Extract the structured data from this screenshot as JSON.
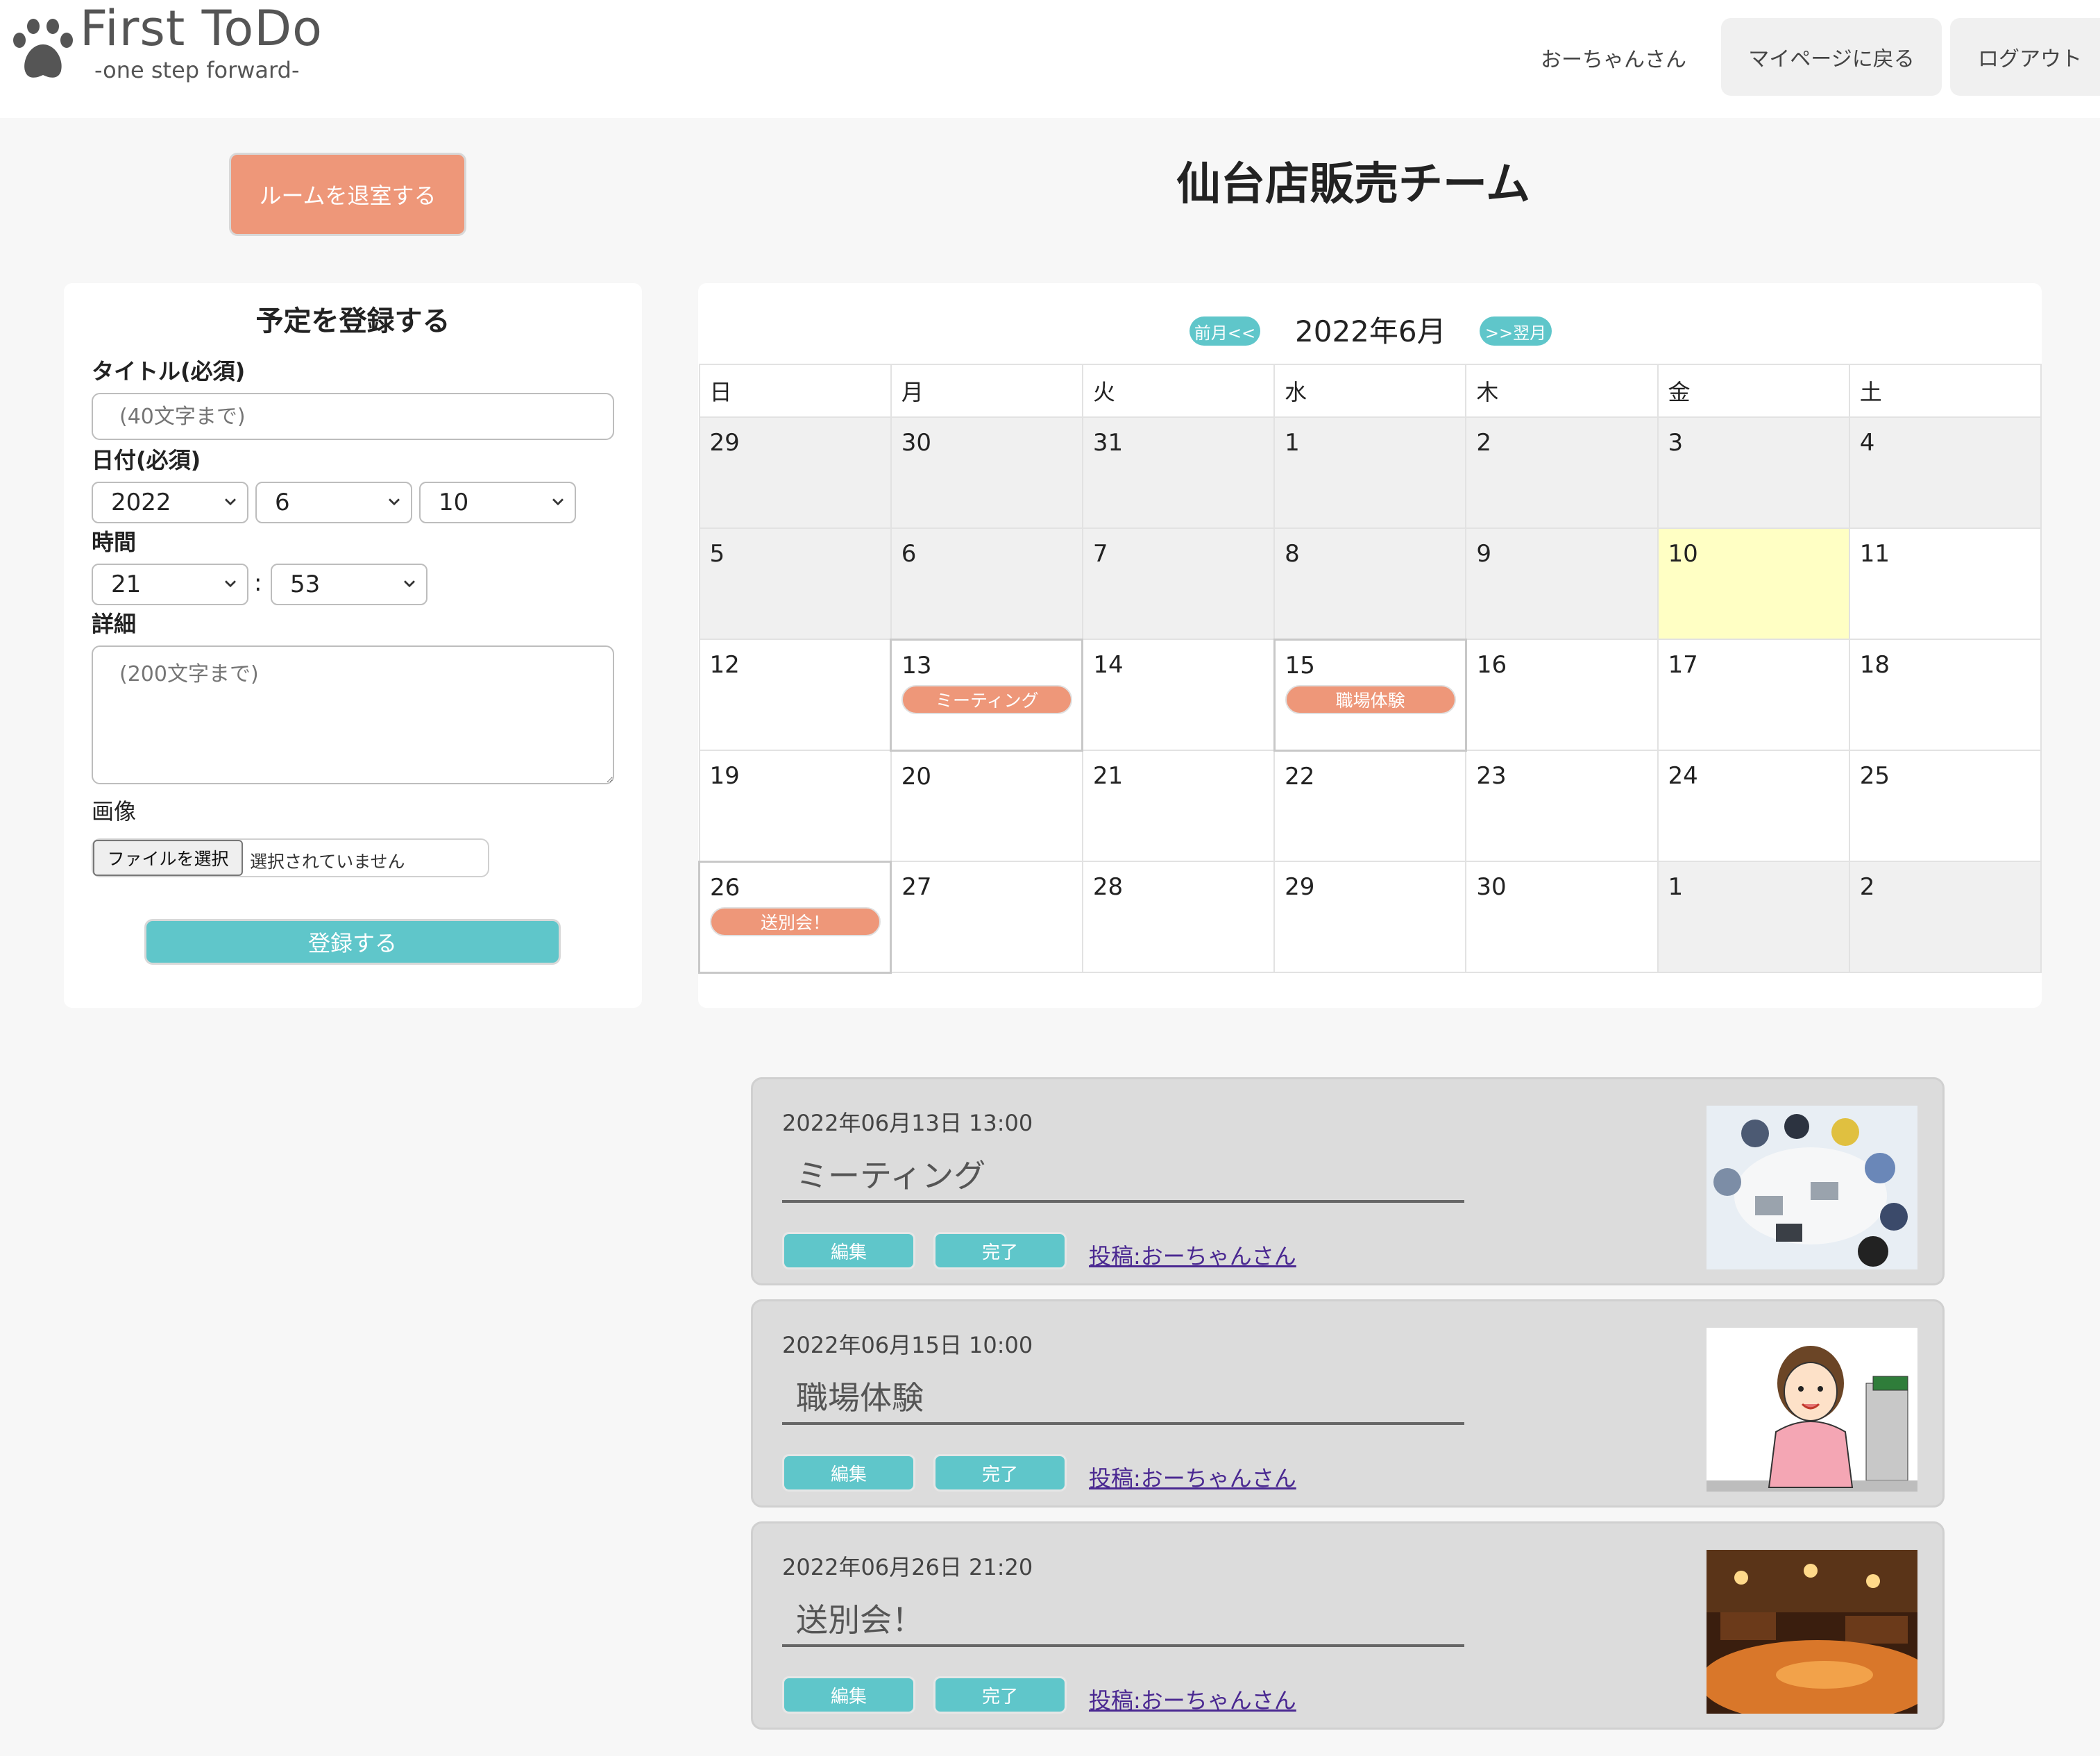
{
  "header": {
    "logo_title": "First ToDo",
    "logo_subtitle": "-one step forward-",
    "user_name": "おーちゃんさん",
    "mypage_label": "マイページに戻る",
    "logout_label": "ログアウト"
  },
  "room": {
    "leave_label": "ルームを退室する",
    "title": "仙台店販売チーム"
  },
  "form": {
    "heading": "予定を登録する",
    "title_label": "タイトル(必須)",
    "title_placeholder": "(40文字まで)",
    "date_label": "日付(必須)",
    "year_value": "2022",
    "month_value": "6",
    "day_value": "10",
    "time_label": "時間",
    "hour_value": "21",
    "time_separator": ":",
    "minute_value": "53",
    "detail_label": "詳細",
    "detail_placeholder": "(200文字まで)",
    "image_label": "画像",
    "file_button": "ファイルを選択",
    "file_status": "選択されていません",
    "submit_label": "登録する"
  },
  "calendar": {
    "prev_label": "前月<<",
    "month_label": "2022年6月",
    "next_label": ">>翌月",
    "weekdays": [
      "日",
      "月",
      "火",
      "水",
      "木",
      "金",
      "土"
    ],
    "weeks": [
      [
        "29",
        "30",
        "31",
        "1",
        "2",
        "3",
        "4"
      ],
      [
        "5",
        "6",
        "7",
        "8",
        "9",
        "10",
        "11"
      ],
      [
        "12",
        "13",
        "14",
        "15",
        "16",
        "17",
        "18"
      ],
      [
        "19",
        "20",
        "21",
        "22",
        "23",
        "24",
        "25"
      ],
      [
        "26",
        "27",
        "28",
        "29",
        "30",
        "1",
        "2"
      ]
    ],
    "events": {
      "e13": "ミーティング",
      "e15": "職場体験",
      "e26": "送別会！"
    }
  },
  "items": [
    {
      "datetime": "2022年06月13日 13:00",
      "title": "ミーティング",
      "edit_label": "編集",
      "done_label": "完了",
      "poster": "投稿:おーちゃんさん"
    },
    {
      "datetime": "2022年06月15日 10:00",
      "title": "職場体験",
      "edit_label": "編集",
      "done_label": "完了",
      "poster": "投稿:おーちゃんさん"
    },
    {
      "datetime": "2022年06月26日 21:20",
      "title": "送別会！",
      "edit_label": "編集",
      "done_label": "完了",
      "poster": "投稿:おーちゃんさん"
    }
  ],
  "colors": {
    "accent_teal": "#5fc6ca",
    "accent_salmon": "#ee9779",
    "today_highlight": "#ffffc4",
    "other_month_bg": "#f0f0f0"
  }
}
